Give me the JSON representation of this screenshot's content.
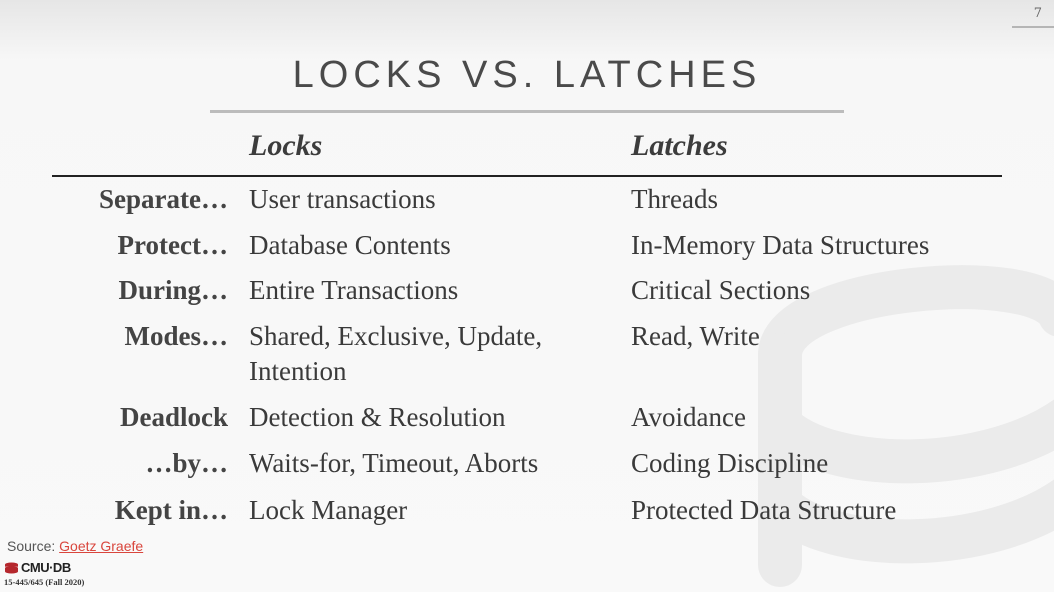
{
  "page_number": "7",
  "title": "LOCKS VS. LATCHES",
  "columns": {
    "locks": "Locks",
    "latches": "Latches"
  },
  "rows": [
    {
      "label": "Separate…",
      "locks": "User transactions",
      "latches": "Threads"
    },
    {
      "label": "Protect…",
      "locks": "Database Contents",
      "latches": "In-Memory Data Structures"
    },
    {
      "label": "During…",
      "locks": "Entire Transactions",
      "latches": "Critical Sections"
    },
    {
      "label": "Modes…",
      "locks": "Shared, Exclusive, Update, Intention",
      "latches": "Read, Write"
    },
    {
      "label": "Deadlock",
      "locks": "Detection & Resolution",
      "latches": "Avoidance"
    },
    {
      "label": "…by…",
      "locks": "Waits-for, Timeout, Aborts",
      "latches": "Coding Discipline"
    },
    {
      "label": "Kept in…",
      "locks": "Lock Manager",
      "latches": "Protected Data Structure"
    }
  ],
  "source": {
    "prefix": "Source: ",
    "link_text": "Goetz Graefe",
    "link_color": "#d9463d"
  },
  "footer": {
    "brand": "CMU·DB",
    "course": "15-445/645 (Fall 2020)",
    "brand_color": "#b5272d"
  },
  "icons": {
    "background": "database-cylinder-icon",
    "logo": "cmu-db-logo-icon"
  }
}
